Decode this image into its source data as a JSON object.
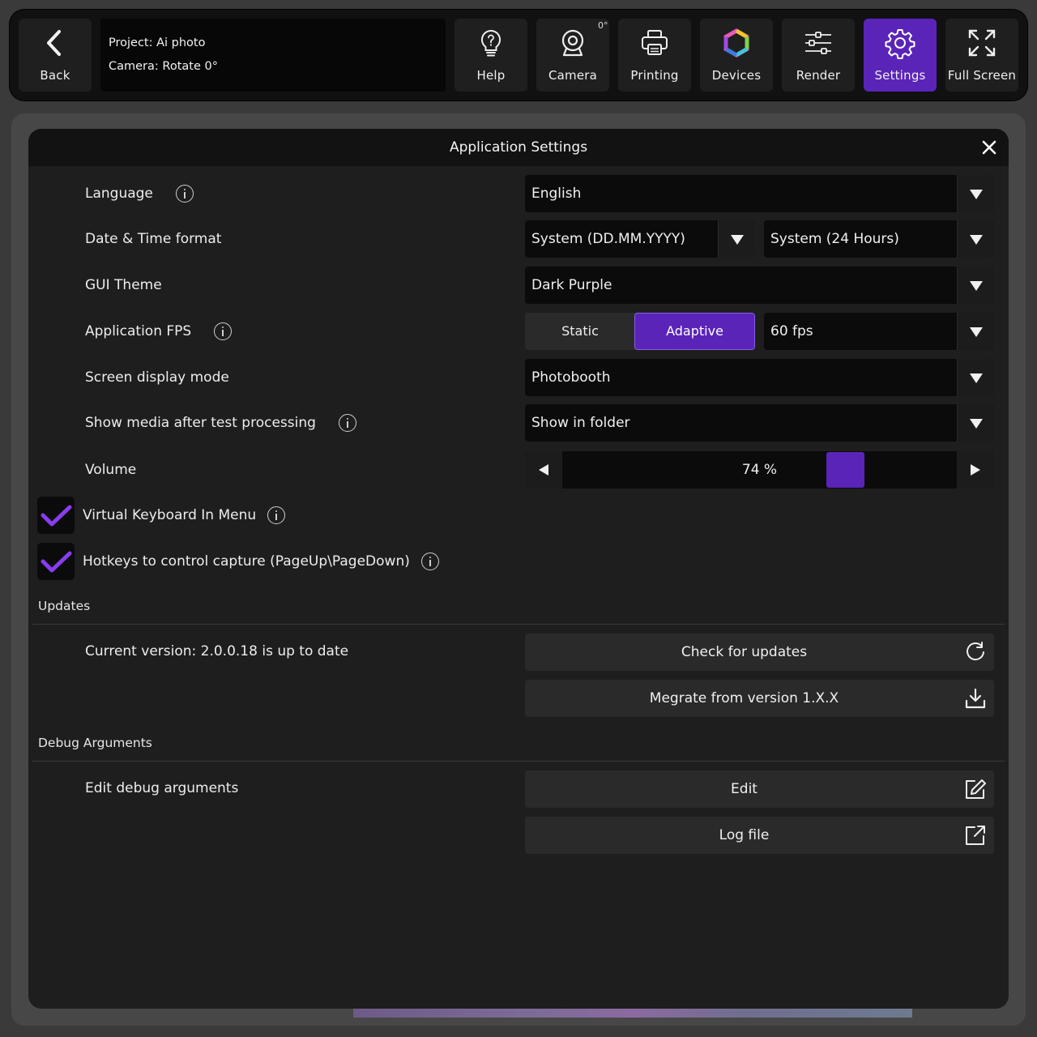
{
  "toolbar": {
    "back_label": "Back",
    "project_line": "Project: Ai photo",
    "camera_line": "Camera: Rotate 0°",
    "camera_rotation_badge": "0°",
    "buttons": [
      {
        "label": "Help",
        "icon": "lightbulb-question-icon"
      },
      {
        "label": "Camera",
        "icon": "webcam-icon"
      },
      {
        "label": "Printing",
        "icon": "printer-icon"
      },
      {
        "label": "Devices",
        "icon": "color-ring-icon"
      },
      {
        "label": "Render",
        "icon": "sliders-icon"
      },
      {
        "label": "Settings",
        "icon": "gear-icon",
        "active": true
      },
      {
        "label": "Full Screen",
        "icon": "expand-icon"
      }
    ]
  },
  "modal": {
    "title": "Application Settings",
    "close_icon": "close-icon"
  },
  "settings": {
    "language": {
      "label": "Language",
      "value": "English"
    },
    "datetime": {
      "label": "Date & Time format",
      "date_value": "System (DD.MM.YYYY)",
      "time_value": "System (24 Hours)"
    },
    "theme": {
      "label": "GUI Theme",
      "value": "Dark Purple"
    },
    "fps": {
      "label": "Application FPS",
      "options": [
        "Static",
        "Adaptive"
      ],
      "selected": "Adaptive",
      "value": "60 fps"
    },
    "display_mode": {
      "label": "Screen display mode",
      "value": "Photobooth"
    },
    "show_media": {
      "label": "Show media after test processing",
      "value": "Show in folder"
    },
    "volume": {
      "label": "Volume",
      "value_text": "74 %",
      "value": 74
    },
    "virtual_keyboard": {
      "label": "Virtual Keyboard In Menu",
      "checked": true
    },
    "hotkeys": {
      "label": "Hotkeys to control capture (PageUp\\PageDown)",
      "checked": true
    }
  },
  "updates": {
    "section_title": "Updates",
    "current_version": "Current version: 2.0.0.18 is up to date",
    "check_label": "Check for updates",
    "migrate_label": "Megrate from version 1.X.X"
  },
  "debug": {
    "section_title": "Debug Arguments",
    "edit_label_text": "Edit debug arguments",
    "edit_button": "Edit",
    "log_button": "Log file"
  },
  "colors": {
    "accent": "#5a24b8",
    "check": "#8a3cf0",
    "toolbar_bg": "#111111",
    "modal_bg": "#1e1e1e"
  }
}
